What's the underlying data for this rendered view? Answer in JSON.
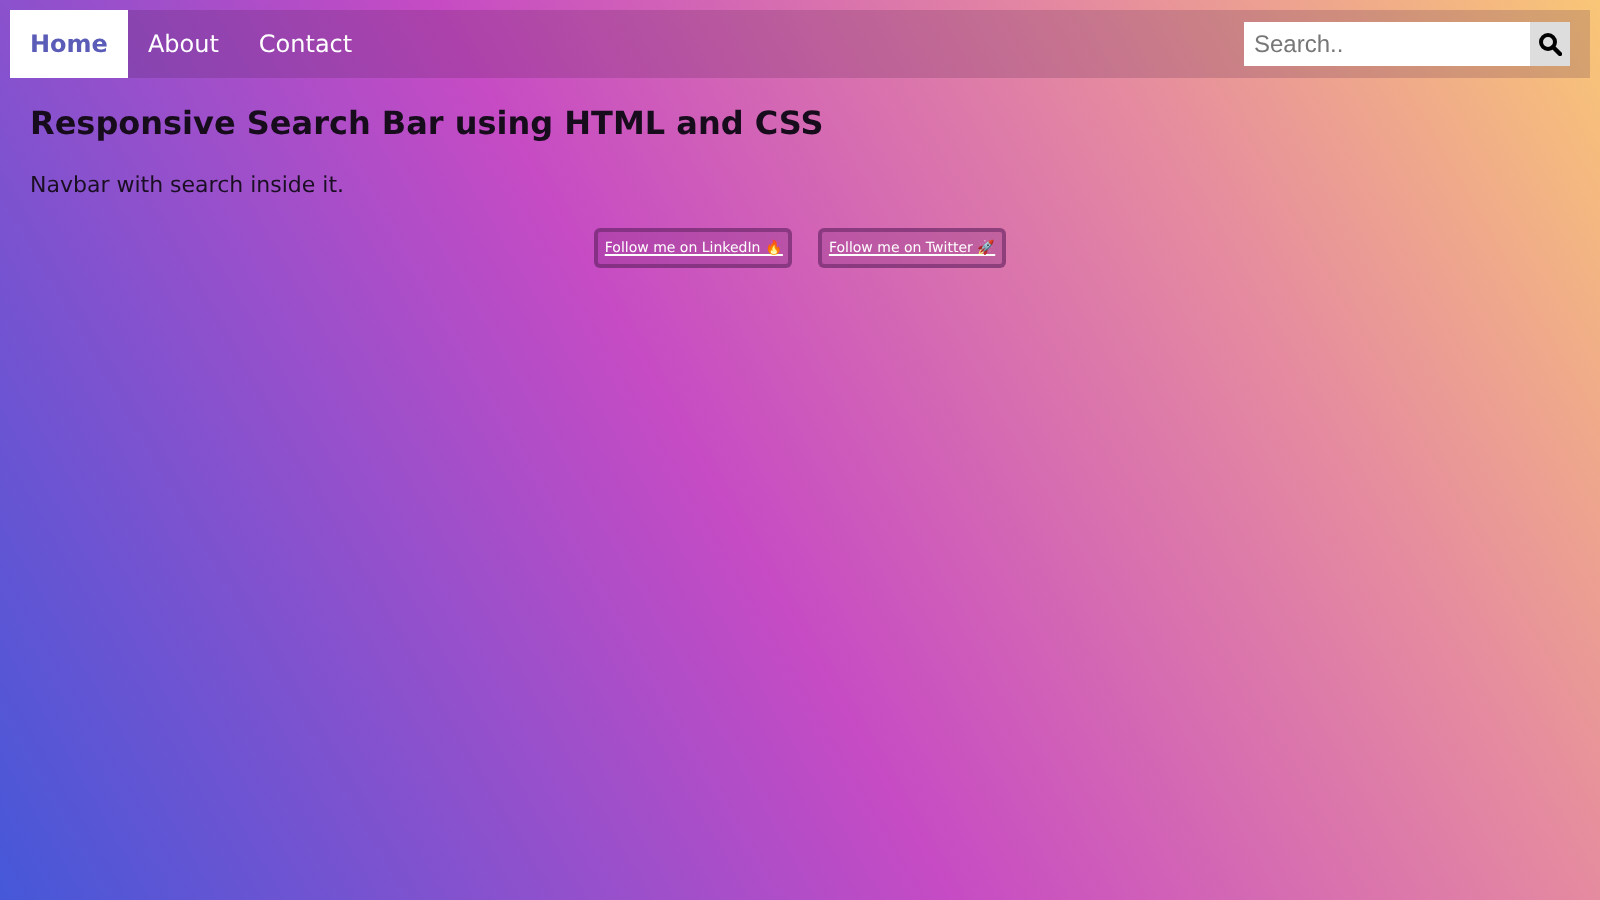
{
  "nav": {
    "tabs": [
      {
        "label": "Home",
        "selected": true
      },
      {
        "label": "About",
        "selected": false
      },
      {
        "label": "Contact",
        "selected": false
      }
    ],
    "search": {
      "placeholder": "Search.."
    }
  },
  "heading": "Responsive Search Bar using HTML and CSS",
  "subtitle": "Navbar with search inside it.",
  "links": [
    "Follow me on LinkedIn 🔥",
    "Follow me on Twitter 🚀"
  ]
}
